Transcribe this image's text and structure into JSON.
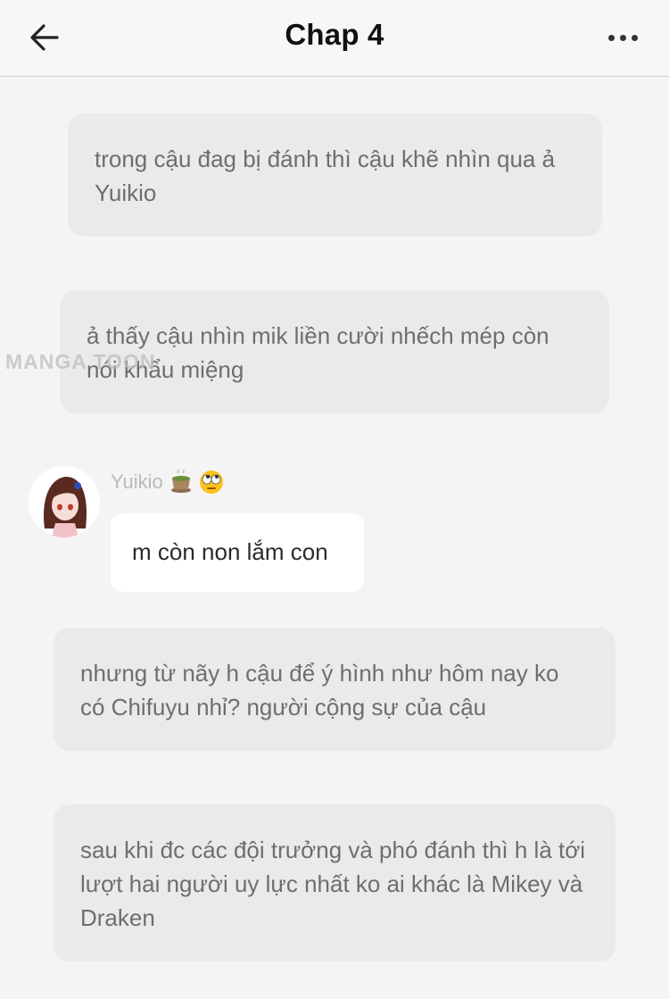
{
  "header": {
    "title": "Chap 4",
    "back_icon": "arrow-left-icon",
    "menu_icon": "more-horizontal-icon"
  },
  "messages": [
    {
      "type": "narration",
      "text": "trong cậu đag bị đánh thì cậu khẽ nhìn qua ả Yuikio"
    },
    {
      "type": "narration",
      "text": "ả thấy cậu nhìn mik liền cười nhếch mép còn nói khẩu miệng"
    },
    {
      "type": "character",
      "name": "Yuikio",
      "emojis": [
        "tea-icon",
        "rolling-eyes-icon"
      ],
      "text": "m còn non lắm con"
    },
    {
      "type": "narration",
      "text": "nhưng từ nãy h cậu để ý hình như hôm nay ko có Chifuyu nhỉ? người cộng sự của cậu"
    },
    {
      "type": "narration",
      "text": "sau khi đc các đội trưởng và phó đánh thì h là tới lượt hai người uy lực nhất ko ai khác là Mikey và Draken"
    }
  ],
  "watermark": "MANGA TOON",
  "colors": {
    "background": "#f4f4f4",
    "narration_bubble": "#eaeaea",
    "speech_bubble": "#ffffff",
    "title": "#111111"
  }
}
